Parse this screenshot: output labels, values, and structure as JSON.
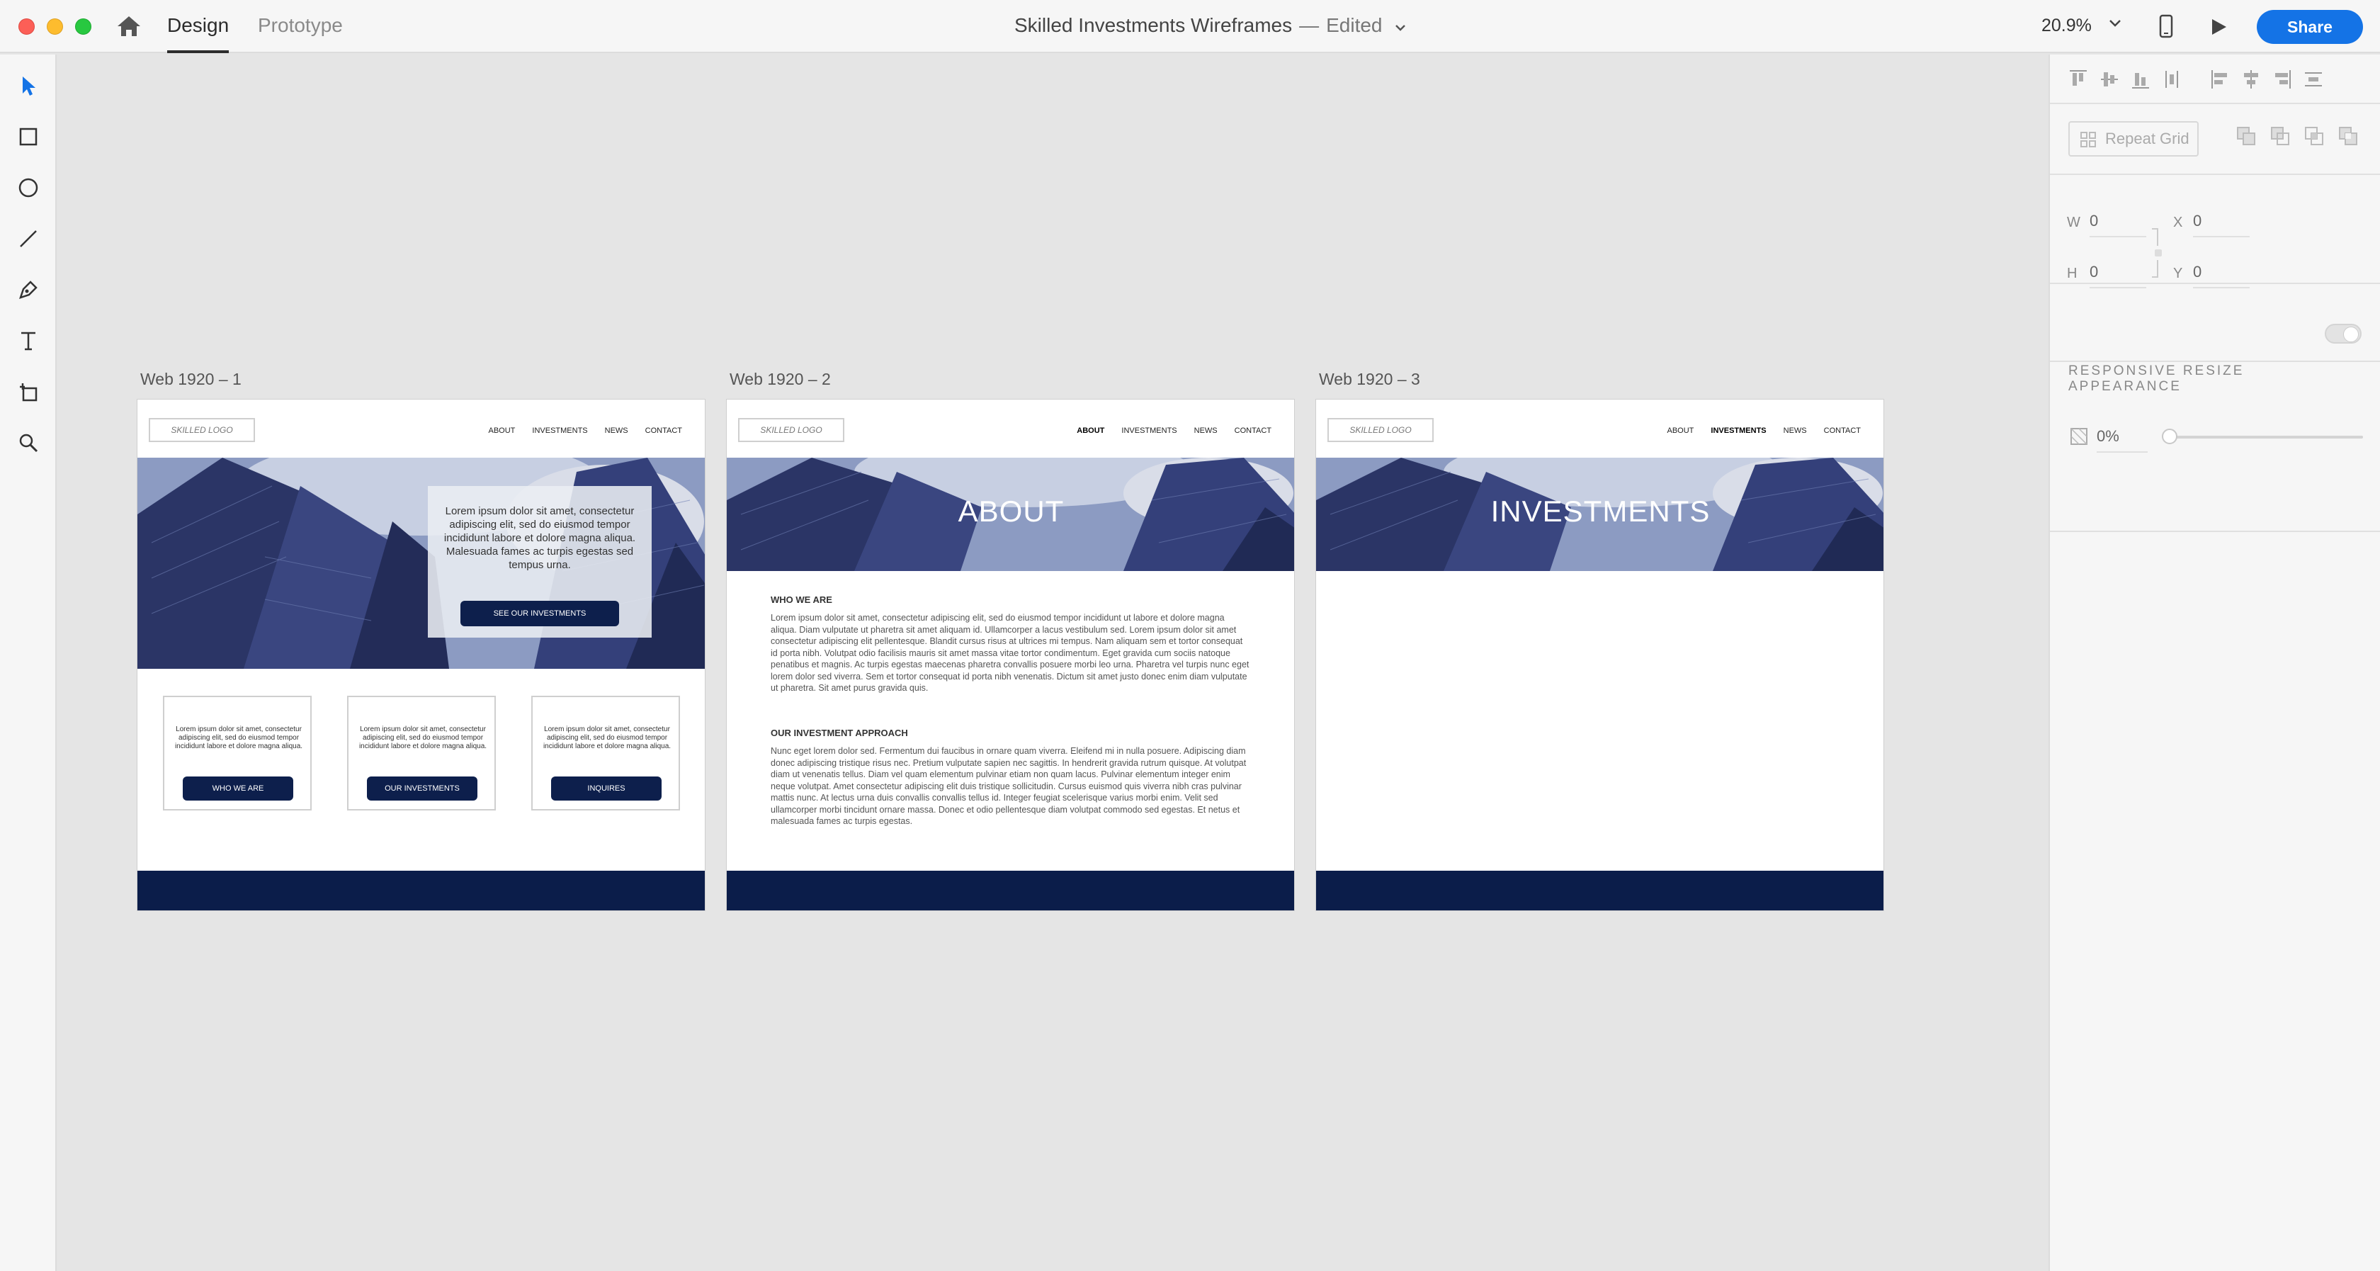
{
  "window": {
    "tabs": [
      {
        "label": "Design"
      },
      {
        "label": "Prototype"
      }
    ],
    "title": "Skilled Investments Wireframes",
    "title_sep": "—",
    "status": "Edited",
    "zoom": "20.9%",
    "share_label": "Share"
  },
  "tools": [
    {
      "icon": "select-arrow-icon"
    },
    {
      "icon": "rectangle-icon"
    },
    {
      "icon": "ellipse-icon"
    },
    {
      "icon": "line-icon"
    },
    {
      "icon": "pen-icon"
    },
    {
      "icon": "text-icon"
    },
    {
      "icon": "artboard-icon"
    },
    {
      "icon": "zoom-icon"
    }
  ],
  "panel": {
    "repeat_grid_label": "Repeat Grid",
    "w_label": "W",
    "w_value": "0",
    "h_label": "H",
    "h_value": "0",
    "x_label": "X",
    "x_value": "0",
    "y_label": "Y",
    "y_value": "0",
    "responsive_resize": "RESPONSIVE RESIZE",
    "appearance": "APPEARANCE",
    "opacity": "0%"
  },
  "artboards": [
    {
      "label": "Web 1920 – 1",
      "logo": "SKILLED LOGO",
      "nav": [
        "ABOUT",
        "INVESTMENTS",
        "NEWS",
        "CONTACT"
      ],
      "hero_text": "Lorem ipsum dolor sit amet, consectetur adipiscing elit, sed do eiusmod tempor incididunt labore et dolore magna aliqua. Malesuada fames ac turpis egestas sed tempus urna.",
      "hero_button": "SEE OUR INVESTMENTS",
      "cards": [
        {
          "text": "Lorem ipsum dolor sit amet, consectetur adipiscing elit, sed do eiusmod tempor incididunt labore et dolore magna aliqua.",
          "button": "WHO WE ARE"
        },
        {
          "text": "Lorem ipsum dolor sit amet, consectetur adipiscing elit, sed do eiusmod tempor incididunt labore et dolore magna aliqua.",
          "button": "OUR INVESTMENTS"
        },
        {
          "text": "Lorem ipsum dolor sit amet, consectetur adipiscing elit, sed do eiusmod tempor incididunt labore et dolore magna aliqua.",
          "button": "INQUIRES"
        }
      ]
    },
    {
      "label": "Web 1920 – 2",
      "logo": "SKILLED LOGO",
      "nav": [
        "ABOUT",
        "INVESTMENTS",
        "NEWS",
        "CONTACT"
      ],
      "hero_title": "ABOUT",
      "section1_title": "WHO WE ARE",
      "section1_text": "Lorem ipsum dolor sit amet, consectetur adipiscing elit, sed do eiusmod tempor incididunt ut labore et dolore magna aliqua. Diam vulputate ut pharetra sit amet aliquam id. Ullamcorper a lacus vestibulum sed. Lorem ipsum dolor sit amet consectetur adipiscing elit pellentesque. Blandit cursus risus at ultrices mi tempus. Nam aliquam sem et tortor consequat id porta nibh. Volutpat odio facilisis mauris sit amet massa vitae tortor condimentum. Eget gravida cum sociis natoque penatibus et magnis. Ac turpis egestas maecenas pharetra convallis posuere morbi leo urna. Pharetra vel turpis nunc eget lorem dolor sed viverra. Sem et tortor consequat id porta nibh venenatis. Dictum sit amet justo donec enim diam vulputate ut pharetra. Sit amet purus gravida quis.",
      "section2_title": "OUR INVESTMENT APPROACH",
      "section2_text": "Nunc eget lorem dolor sed. Fermentum dui faucibus in ornare quam viverra. Eleifend mi in nulla posuere. Adipiscing diam donec adipiscing tristique risus nec. Pretium vulputate sapien nec sagittis. In hendrerit gravida rutrum quisque. At volutpat diam ut venenatis tellus. Diam vel quam elementum pulvinar etiam non quam lacus. Pulvinar elementum integer enim neque volutpat. Amet consectetur adipiscing elit duis tristique sollicitudin. Cursus euismod quis viverra nibh cras pulvinar mattis nunc. At lectus urna duis convallis convallis tellus id. Integer feugiat scelerisque varius morbi enim. Velit sed ullamcorper morbi tincidunt ornare massa. Donec et odio pellentesque diam volutpat commodo sed egestas. Et netus et malesuada fames ac turpis egestas."
    },
    {
      "label": "Web 1920 – 3",
      "logo": "SKILLED LOGO",
      "nav": [
        "ABOUT",
        "INVESTMENTS",
        "NEWS",
        "CONTACT"
      ],
      "hero_title": "INVESTMENTS"
    }
  ],
  "colors": {
    "accent": "#1473e6",
    "navy": "#0d1f4c",
    "footer": "#0b1d4a",
    "canvas": "#e5e5e5"
  }
}
